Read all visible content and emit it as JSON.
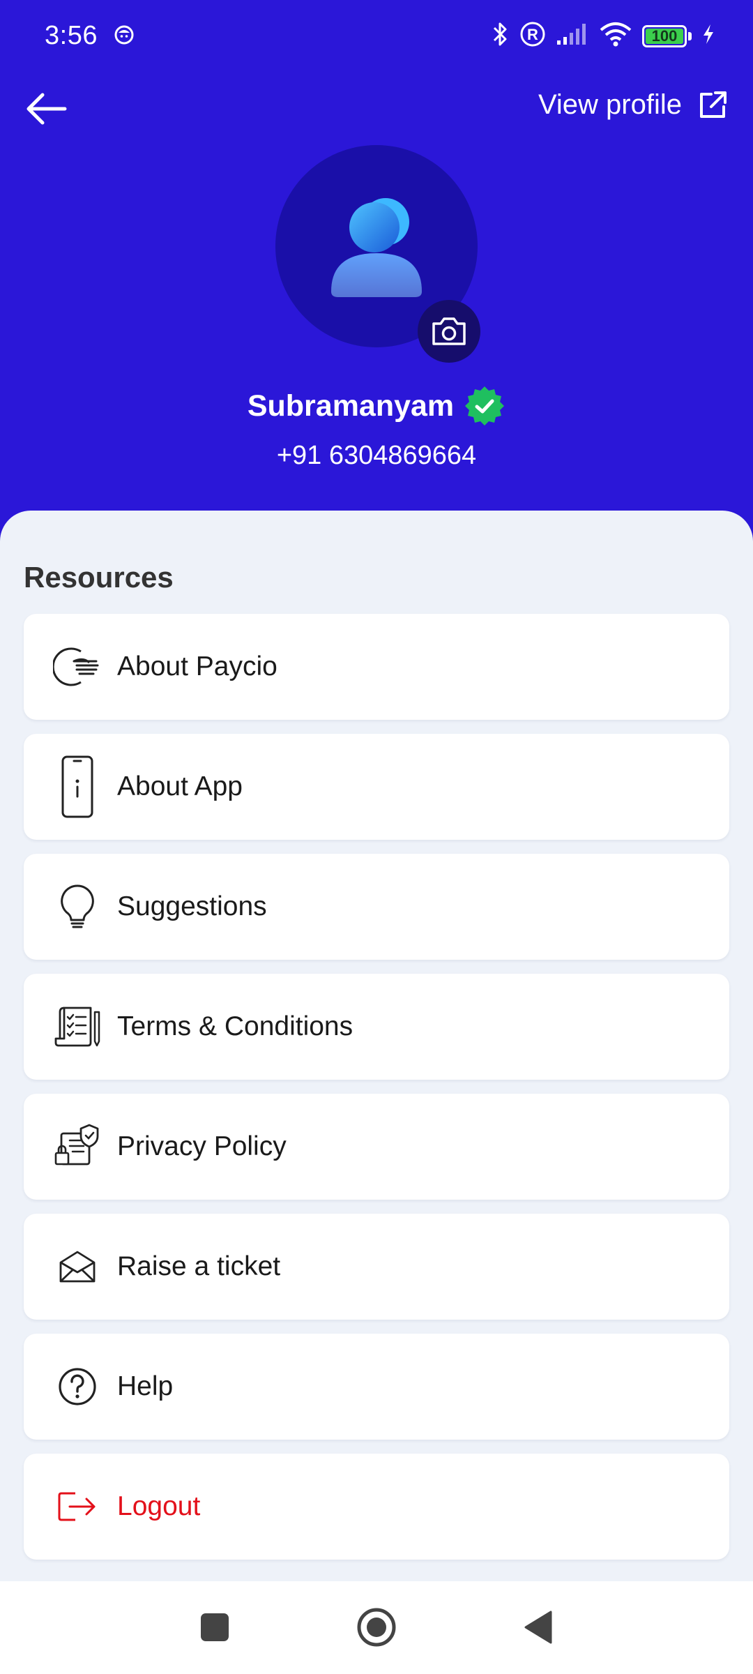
{
  "status_bar": {
    "time": "3:56",
    "battery": "100",
    "icons": [
      "bluetooth-icon",
      "registered-icon",
      "signal-icon",
      "wifi-icon",
      "battery-icon",
      "charging-icon"
    ]
  },
  "header": {
    "view_profile": "View profile",
    "user_name": "Subramanyam",
    "phone": "+91 6304869664",
    "background_color": "#2b17d8"
  },
  "resources": {
    "title": "Resources",
    "items": [
      {
        "label": "About Paycio",
        "icon": "paycio-logo-icon"
      },
      {
        "label": "About App",
        "icon": "phone-info-icon"
      },
      {
        "label": "Suggestions",
        "icon": "lightbulb-icon"
      },
      {
        "label": "Terms & Conditions",
        "icon": "checklist-document-icon"
      },
      {
        "label": "Privacy Policy",
        "icon": "privacy-shield-icon"
      },
      {
        "label": "Raise a ticket",
        "icon": "envelope-icon"
      },
      {
        "label": "Help",
        "icon": "question-circle-icon"
      },
      {
        "label": "Logout",
        "icon": "logout-icon",
        "color": "#e3101a"
      }
    ]
  },
  "nav": [
    "square-icon",
    "home-circle-icon",
    "back-triangle-icon"
  ]
}
